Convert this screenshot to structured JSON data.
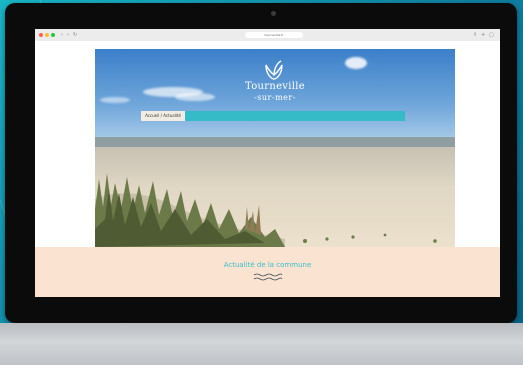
{
  "browser": {
    "url": "tourneville.fr",
    "nav_icons": [
      "back-icon",
      "forward-icon",
      "refresh-icon"
    ],
    "toolbar_icons": [
      "share-icon",
      "add-tab-icon",
      "tabs-icon"
    ]
  },
  "site": {
    "logo_name": "Tourneville",
    "logo_sub": "-sur-mer-",
    "menu": {
      "active": "Accueil / Actualité",
      "items": [
        "",
        "",
        "",
        "",
        ""
      ]
    },
    "section_title": "Actualité de la commune"
  },
  "colors": {
    "background": "#14a8bf",
    "accent": "#2abcc4",
    "band": "#fbe3d2",
    "title": "#3bbec9"
  }
}
